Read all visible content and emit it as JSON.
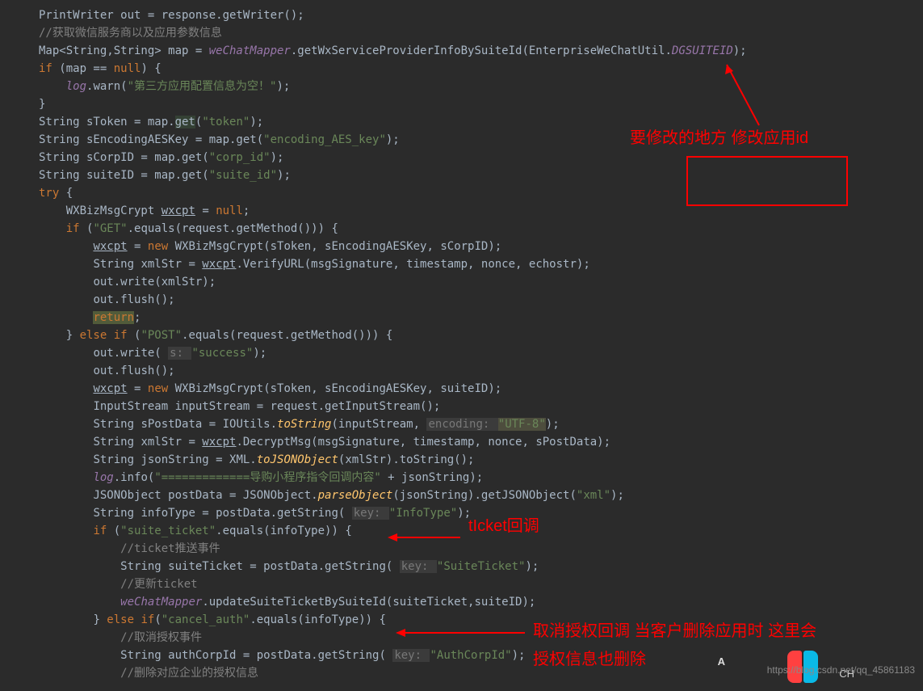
{
  "code": {
    "lines": [
      {
        "indent": 0,
        "segments": [
          {
            "t": "PrintWriter out = response.getWriter();",
            "c": "type"
          }
        ]
      },
      {
        "indent": 0,
        "segments": [
          {
            "t": "//获取微信服务商以及应用参数信息",
            "c": "comment"
          }
        ]
      },
      {
        "indent": 0,
        "segments": [
          {
            "t": "Map<String,String> map = ",
            "c": "type"
          },
          {
            "t": "weChatMapper",
            "c": "field-italic"
          },
          {
            "t": ".getWxServiceProviderInfoBySuiteId(EnterpriseWeChatUtil.",
            "c": "type"
          },
          {
            "t": "DGSUITEID",
            "c": "field-italic"
          },
          {
            "t": ");",
            "c": "type"
          }
        ]
      },
      {
        "indent": 0,
        "segments": [
          {
            "t": "if",
            "c": "keyword"
          },
          {
            "t": " (map == ",
            "c": "type"
          },
          {
            "t": "null",
            "c": "keyword"
          },
          {
            "t": ") {",
            "c": "type"
          }
        ]
      },
      {
        "indent": 1,
        "segments": [
          {
            "t": "log",
            "c": "field-italic"
          },
          {
            "t": ".warn(",
            "c": "type"
          },
          {
            "t": "\"第三方应用配置信息为空！\"",
            "c": "string"
          },
          {
            "t": ");",
            "c": "type"
          }
        ]
      },
      {
        "indent": 0,
        "segments": [
          {
            "t": "}",
            "c": "type"
          }
        ]
      },
      {
        "indent": 0,
        "segments": [
          {
            "t": "String sToken = map.",
            "c": "type"
          },
          {
            "t": "get",
            "c": "highlight-bg"
          },
          {
            "t": "(",
            "c": "type"
          },
          {
            "t": "\"token\"",
            "c": "string"
          },
          {
            "t": ");",
            "c": "type"
          }
        ]
      },
      {
        "indent": 0,
        "segments": [
          {
            "t": "String sEncodingAESKey = map.get(",
            "c": "type"
          },
          {
            "t": "\"encoding_AES_key\"",
            "c": "string"
          },
          {
            "t": ");",
            "c": "type"
          }
        ]
      },
      {
        "indent": 0,
        "segments": [
          {
            "t": "String sCorpID = map.get(",
            "c": "type"
          },
          {
            "t": "\"corp_id\"",
            "c": "string"
          },
          {
            "t": ");",
            "c": "type"
          }
        ]
      },
      {
        "indent": 0,
        "segments": [
          {
            "t": "String suiteID = map.get(",
            "c": "type"
          },
          {
            "t": "\"suite_id\"",
            "c": "string"
          },
          {
            "t": ");",
            "c": "type"
          }
        ]
      },
      {
        "indent": 0,
        "segments": [
          {
            "t": "try",
            "c": "keyword"
          },
          {
            "t": " {",
            "c": "type"
          }
        ]
      },
      {
        "indent": 1,
        "segments": [
          {
            "t": "WXBizMsgCrypt ",
            "c": "type"
          },
          {
            "t": "wxcpt",
            "c": "underline"
          },
          {
            "t": " = ",
            "c": "type"
          },
          {
            "t": "null",
            "c": "keyword"
          },
          {
            "t": ";",
            "c": "type"
          }
        ]
      },
      {
        "indent": 1,
        "segments": [
          {
            "t": "if",
            "c": "keyword"
          },
          {
            "t": " (",
            "c": "type"
          },
          {
            "t": "\"GET\"",
            "c": "string"
          },
          {
            "t": ".equals(request.getMethod())) {",
            "c": "type"
          }
        ]
      },
      {
        "indent": 2,
        "segments": [
          {
            "t": "wxcpt",
            "c": "underline"
          },
          {
            "t": " = ",
            "c": "type"
          },
          {
            "t": "new",
            "c": "keyword"
          },
          {
            "t": " WXBizMsgCrypt(sToken, sEncodingAESKey, sCorpID);",
            "c": "type"
          }
        ]
      },
      {
        "indent": 2,
        "segments": [
          {
            "t": "String xmlStr = ",
            "c": "type"
          },
          {
            "t": "wxcpt",
            "c": "underline"
          },
          {
            "t": ".VerifyURL(msgSignature, timestamp, nonce, echostr);",
            "c": "type"
          }
        ]
      },
      {
        "indent": 2,
        "segments": [
          {
            "t": "out.write(xmlStr);",
            "c": "type"
          }
        ]
      },
      {
        "indent": 2,
        "segments": [
          {
            "t": "out.flush();",
            "c": "type"
          }
        ]
      },
      {
        "indent": 2,
        "segments": [
          {
            "t": "return",
            "c": "highlight-return"
          },
          {
            "t": ";",
            "c": "type"
          }
        ]
      },
      {
        "indent": 1,
        "segments": [
          {
            "t": "} ",
            "c": "type"
          },
          {
            "t": "else if",
            "c": "keyword"
          },
          {
            "t": " (",
            "c": "type"
          },
          {
            "t": "\"POST\"",
            "c": "string"
          },
          {
            "t": ".equals(request.getMethod())) {",
            "c": "type"
          }
        ]
      },
      {
        "indent": 2,
        "segments": [
          {
            "t": "out.write( ",
            "c": "type"
          },
          {
            "t": "s: ",
            "c": "param-hint"
          },
          {
            "t": "\"success\"",
            "c": "string"
          },
          {
            "t": ");",
            "c": "type"
          }
        ]
      },
      {
        "indent": 2,
        "segments": [
          {
            "t": "out.flush();",
            "c": "type"
          }
        ]
      },
      {
        "indent": 2,
        "segments": [
          {
            "t": "wxcpt",
            "c": "underline"
          },
          {
            "t": " = ",
            "c": "type"
          },
          {
            "t": "new",
            "c": "keyword"
          },
          {
            "t": " WXBizMsgCrypt(sToken, sEncodingAESKey, suiteID);",
            "c": "type"
          }
        ]
      },
      {
        "indent": 2,
        "segments": [
          {
            "t": "InputStream inputStream = request.getInputStream();",
            "c": "type"
          }
        ]
      },
      {
        "indent": 2,
        "segments": [
          {
            "t": "String sPostData = IOUtils.",
            "c": "type"
          },
          {
            "t": "toString",
            "c": "method-italic"
          },
          {
            "t": "(inputStream, ",
            "c": "type"
          },
          {
            "t": "encoding: ",
            "c": "param-hint"
          },
          {
            "t": "\"UTF-8\"",
            "c": "string-hl"
          },
          {
            "t": ");",
            "c": "type"
          }
        ]
      },
      {
        "indent": 2,
        "segments": [
          {
            "t": "String xmlStr = ",
            "c": "type"
          },
          {
            "t": "wxcpt",
            "c": "underline"
          },
          {
            "t": ".DecryptMsg(msgSignature, timestamp, nonce, sPostData);",
            "c": "type"
          }
        ]
      },
      {
        "indent": 2,
        "segments": [
          {
            "t": "String jsonString = XML.",
            "c": "type"
          },
          {
            "t": "toJSONObject",
            "c": "method-italic"
          },
          {
            "t": "(xmlStr).toString();",
            "c": "type"
          }
        ]
      },
      {
        "indent": 2,
        "segments": [
          {
            "t": "log",
            "c": "field-italic"
          },
          {
            "t": ".info(",
            "c": "type"
          },
          {
            "t": "\"=============导购小程序指令回调内容\"",
            "c": "string"
          },
          {
            "t": " + jsonString);",
            "c": "type"
          }
        ]
      },
      {
        "indent": 2,
        "segments": [
          {
            "t": "JSONObject postData = JSONObject.",
            "c": "type"
          },
          {
            "t": "parseObject",
            "c": "method-italic"
          },
          {
            "t": "(jsonString).getJSONObject(",
            "c": "type"
          },
          {
            "t": "\"xml\"",
            "c": "string"
          },
          {
            "t": ");",
            "c": "type"
          }
        ]
      },
      {
        "indent": 2,
        "segments": [
          {
            "t": "String infoType = postData.getString( ",
            "c": "type"
          },
          {
            "t": "key: ",
            "c": "param-hint"
          },
          {
            "t": "\"InfoType\"",
            "c": "string"
          },
          {
            "t": ");",
            "c": "type"
          }
        ]
      },
      {
        "indent": 2,
        "segments": [
          {
            "t": "if",
            "c": "keyword"
          },
          {
            "t": " (",
            "c": "type"
          },
          {
            "t": "\"suite_ticket\"",
            "c": "string"
          },
          {
            "t": ".equals(infoType)) {",
            "c": "type"
          }
        ]
      },
      {
        "indent": 3,
        "segments": [
          {
            "t": "//ticket推送事件",
            "c": "comment"
          }
        ]
      },
      {
        "indent": 3,
        "segments": [
          {
            "t": "String suiteTicket = postData.getString( ",
            "c": "type"
          },
          {
            "t": "key: ",
            "c": "param-hint"
          },
          {
            "t": "\"SuiteTicket\"",
            "c": "string"
          },
          {
            "t": ");",
            "c": "type"
          }
        ]
      },
      {
        "indent": 3,
        "segments": [
          {
            "t": "//更新ticket",
            "c": "comment"
          }
        ]
      },
      {
        "indent": 3,
        "segments": [
          {
            "t": "weChatMapper",
            "c": "field-italic"
          },
          {
            "t": ".updateSuiteTicketBySuiteId(suiteTicket,suiteID);",
            "c": "type"
          }
        ]
      },
      {
        "indent": 2,
        "segments": [
          {
            "t": "} ",
            "c": "type"
          },
          {
            "t": "else if",
            "c": "keyword"
          },
          {
            "t": "(",
            "c": "type"
          },
          {
            "t": "\"cancel_auth\"",
            "c": "string"
          },
          {
            "t": ".equals(infoType)) {",
            "c": "type"
          }
        ]
      },
      {
        "indent": 3,
        "segments": [
          {
            "t": "//取消授权事件",
            "c": "comment"
          }
        ]
      },
      {
        "indent": 3,
        "segments": [
          {
            "t": "String authCorpId = postData.getString( ",
            "c": "type"
          },
          {
            "t": "key: ",
            "c": "param-hint"
          },
          {
            "t": "\"AuthCorpId\"",
            "c": "string"
          },
          {
            "t": ");",
            "c": "type"
          }
        ]
      },
      {
        "indent": 3,
        "segments": [
          {
            "t": "//删除对应企业的授权信息",
            "c": "comment"
          }
        ]
      }
    ]
  },
  "annotations": {
    "ann1": "要修改的地方  修改应用id",
    "ann2": "tIcket回调",
    "ann3_line1": "取消授权回调 当客户删除应用时 这里会",
    "ann3_line2": "授权信息也删除"
  },
  "watermark": "https://blog.csdn.net/qq_45861183",
  "lang": "CH",
  "letterA": "A"
}
